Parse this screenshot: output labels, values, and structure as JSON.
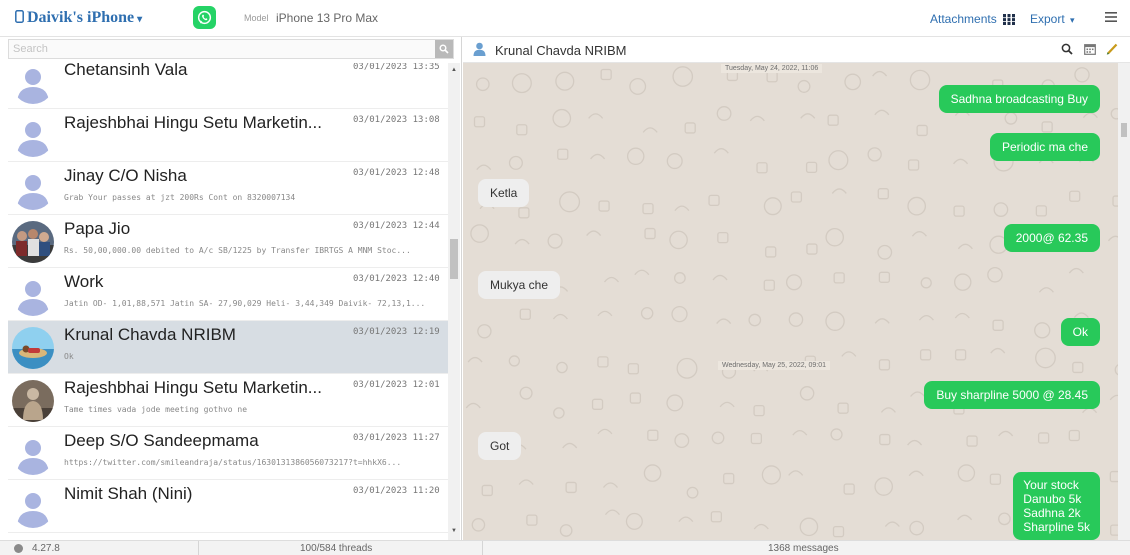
{
  "topbar": {
    "device_name": "Daivik's iPhone",
    "model_label": "Model",
    "model_value": "iPhone 13 Pro Max",
    "attachments_label": "Attachments",
    "export_label": "Export",
    "app_icon": "whatsapp-icon"
  },
  "search": {
    "placeholder": "Search"
  },
  "threads": [
    {
      "name": "Chetansinh Vala",
      "time": "03/01/2023 13:35",
      "snippet": "",
      "avatar": "default"
    },
    {
      "name": "Rajeshbhai Hingu Setu Marketin...",
      "time": "03/01/2023 13:08",
      "snippet": "",
      "avatar": "default"
    },
    {
      "name": "Jinay C/O Nisha",
      "time": "03/01/2023 12:48",
      "snippet": "Grab Your passes at jzt 200Rs Cont on 8320007134",
      "avatar": "default"
    },
    {
      "name": "Papa Jio",
      "time": "03/01/2023 12:44",
      "snippet": "Rs. 50,00,000.00 debited to A/c SB/1225 by Transfer IBRTGS A MNM Stoc...",
      "avatar": "photo-people"
    },
    {
      "name": "Work",
      "time": "03/01/2023 12:40",
      "snippet": "Jatin OD- 1,01,88,571 Jatin SA- 27,90,029 Heli- 3,44,349 Daivik- 72,13,1...",
      "avatar": "default"
    },
    {
      "name": "Krunal Chavda NRIBM",
      "time": "03/01/2023 12:19",
      "snippet": "Ok",
      "avatar": "photo-beach",
      "selected": true
    },
    {
      "name": "Rajeshbhai Hingu Setu Marketin...",
      "time": "03/01/2023 12:01",
      "snippet": "Tame times vada jode meeting gothvo ne",
      "avatar": "photo-statue"
    },
    {
      "name": "Deep S/O Sandeepmama",
      "time": "03/01/2023 11:27",
      "snippet": "https://twitter.com/smileandraja/status/1630131386056073217?t=hhkX6...",
      "avatar": "default"
    },
    {
      "name": "Nimit Shah (Nini)",
      "time": "03/01/2023 11:20",
      "snippet": "",
      "avatar": "default"
    }
  ],
  "chat": {
    "contact": "Krunal Chavda NRIBM",
    "messages": [
      {
        "type": "date",
        "text": "Tuesday, May 24, 2022, 11:06"
      },
      {
        "type": "out",
        "text": "Sadhna broadcasting Buy"
      },
      {
        "type": "out",
        "text": "Periodic ma che"
      },
      {
        "type": "in",
        "text": "Ketla"
      },
      {
        "type": "out",
        "text": "2000@ 62.35"
      },
      {
        "type": "in",
        "text": "Mukya che"
      },
      {
        "type": "out",
        "text": "Ok"
      },
      {
        "type": "date",
        "text": "Wednesday, May 25, 2022, 09:01"
      },
      {
        "type": "out",
        "text": "Buy sharpline 5000 @ 28.45"
      },
      {
        "type": "in",
        "text": "Got"
      },
      {
        "type": "out",
        "lines": [
          "Your stock",
          "Danubo 5k",
          "Sadhna 2k",
          "Sharpline 5k"
        ]
      }
    ]
  },
  "status": {
    "version": "4.27.8",
    "threads": "100/584 threads",
    "messages": "1368 messages"
  },
  "colors": {
    "accent": "#2f6fb0",
    "bubble_out": "#28c95a",
    "bubble_in": "#eeeeee",
    "selected_row": "#d7dde3",
    "chat_bg": "#e4ddd5",
    "whatsapp": "#25d366"
  }
}
